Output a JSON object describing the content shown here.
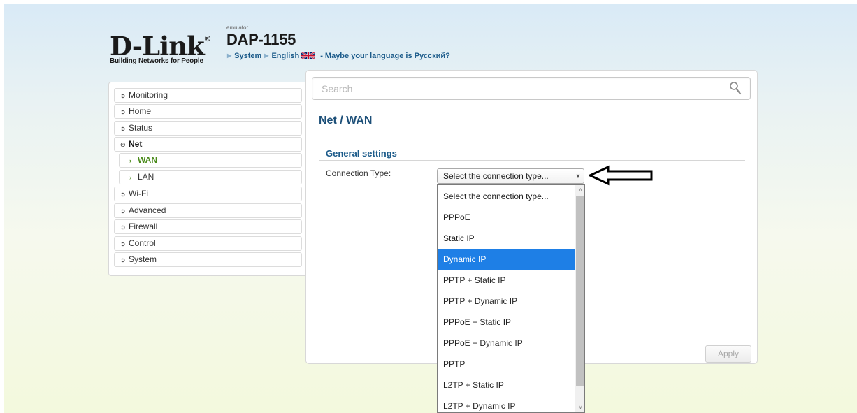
{
  "header": {
    "logo_text": "D-Link",
    "logo_reg": "®",
    "tagline": "Building Networks for People",
    "emulator_label": "emulator",
    "model": "DAP-1155",
    "breadcrumb": {
      "system": "System",
      "language": "English",
      "suggestion": "- Maybe your language is Русский?"
    }
  },
  "sidebar": {
    "items": [
      {
        "label": "Monitoring",
        "icon": "circle-arrow-right-icon"
      },
      {
        "label": "Home",
        "icon": "circle-arrow-right-icon"
      },
      {
        "label": "Status",
        "icon": "circle-arrow-right-icon"
      },
      {
        "label": "Net",
        "icon": "circle-arrow-down-icon"
      },
      {
        "label": "WAN",
        "icon": "chevron-right-icon"
      },
      {
        "label": "LAN",
        "icon": "chevron-right-icon"
      },
      {
        "label": "Wi-Fi",
        "icon": "circle-arrow-right-icon"
      },
      {
        "label": "Advanced",
        "icon": "circle-arrow-right-icon"
      },
      {
        "label": "Firewall",
        "icon": "circle-arrow-right-icon"
      },
      {
        "label": "Control",
        "icon": "circle-arrow-right-icon"
      },
      {
        "label": "System",
        "icon": "circle-arrow-right-icon"
      }
    ]
  },
  "search": {
    "placeholder": "Search"
  },
  "main": {
    "title": "Net /  WAN",
    "section": "General settings",
    "connection_label": "Connection Type:",
    "connection_value": "Select the connection type...",
    "apply_label": "Apply"
  },
  "dropdown": {
    "options": [
      "Select the connection type...",
      "PPPoE",
      "Static IP",
      "Dynamic IP",
      "PPTP + Static IP",
      "PPTP + Dynamic IP",
      "PPPoE + Static IP",
      "PPPoE + Dynamic IP",
      "PPTP",
      "L2TP + Static IP",
      "L2TP + Dynamic IP"
    ],
    "highlighted": "Dynamic IP"
  },
  "colors": {
    "accent_blue": "#1c5b8a",
    "active_green": "#4a8a1a",
    "highlight": "#1e7fe6"
  }
}
